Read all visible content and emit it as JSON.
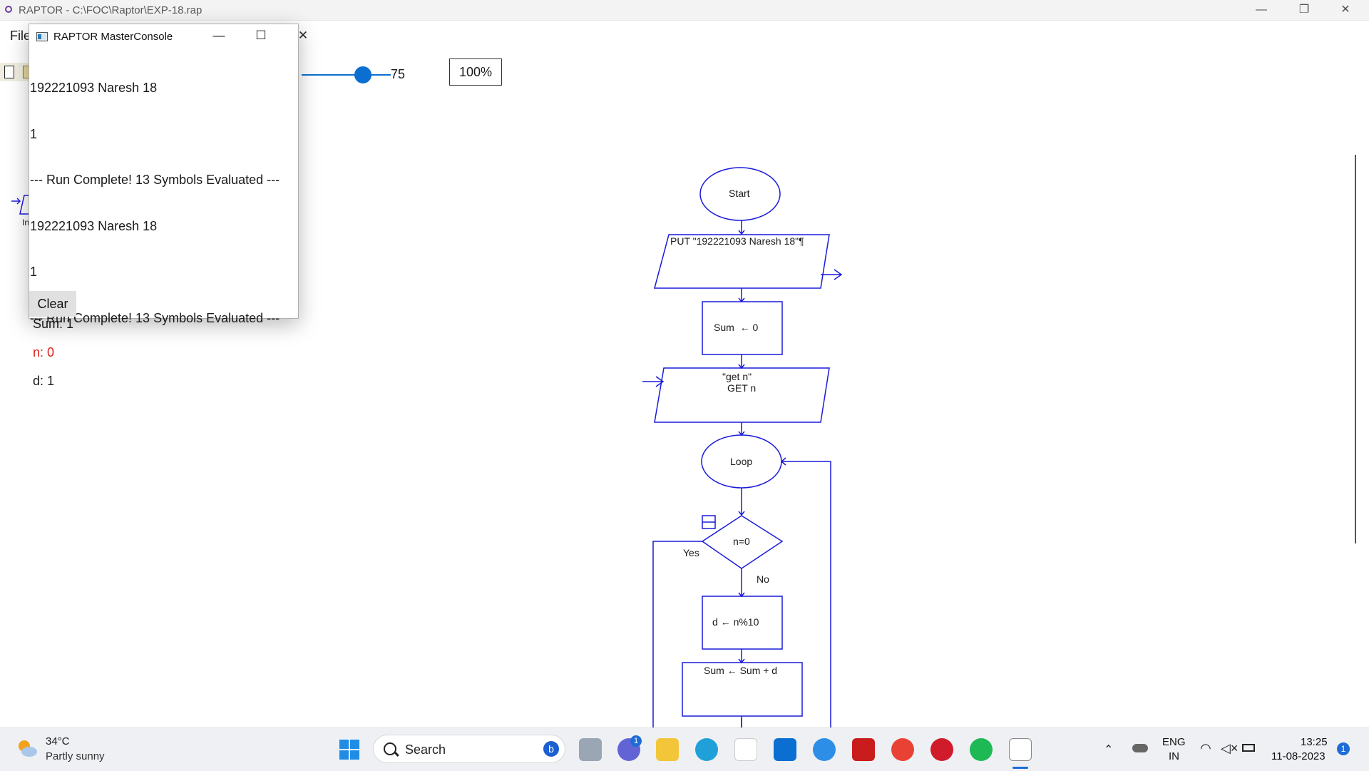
{
  "window": {
    "title": "RAPTOR - C:\\FOC\\Raptor\\EXP-18.rap",
    "minimize": "—",
    "restore": "❐",
    "close": "✕"
  },
  "menu": {
    "file": "File"
  },
  "toolbar": {
    "slider_value": "75",
    "slider_level": 0.6,
    "zoom": "100%"
  },
  "console": {
    "title": "RAPTOR MasterConsole",
    "lines": [
      "192221093 Naresh 18",
      "1",
      "--- Run Complete! 13 Symbols Evaluated ---",
      "192221093 Naresh 18",
      "1",
      "--- Run Complete! 13 Symbols Evaluated ---"
    ],
    "clear_label": "Clear"
  },
  "watch": {
    "sum": "Sum: 1",
    "n": "n: 0",
    "d": "d: 1"
  },
  "left_symbol_label": "In",
  "flowchart": {
    "start": "Start",
    "put": "PUT \"192221093 Naresh 18\"¶",
    "assign_sum": "Sum  ← 0",
    "get_prompt": "\"get n\"",
    "get": "GET n",
    "loop": "Loop",
    "condition": "n=0",
    "yes": "Yes",
    "no": "No",
    "assign_d": "d ← n%10",
    "assign_sum2": "Sum ← Sum + d",
    "color": "#1a1adc"
  },
  "taskbar": {
    "temperature": "34°C",
    "condition": "Partly sunny",
    "search": "Search",
    "language": "ENG",
    "region": "IN",
    "time": "13:25",
    "date": "11-08-2023",
    "teams_badge": "1",
    "notification_count": "1"
  }
}
